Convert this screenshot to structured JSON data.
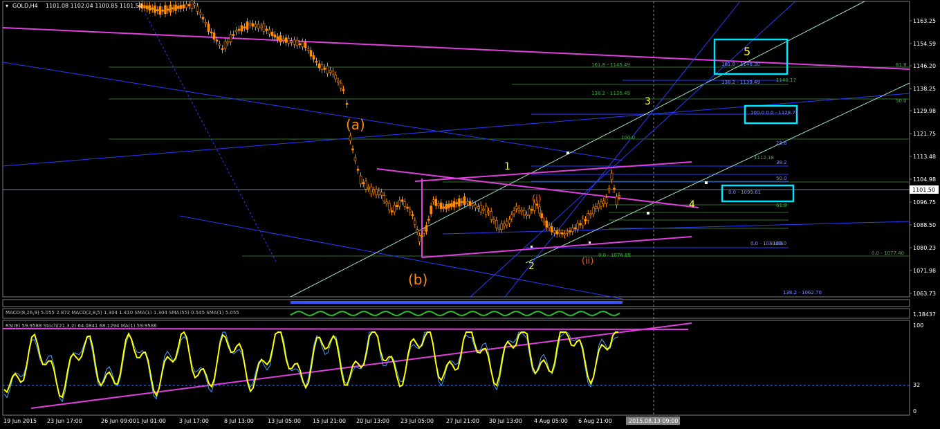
{
  "header": {
    "symbol": "GOLD,H4",
    "ohlc": "1101.08 1102.04 1100.85 1101.50"
  },
  "indicators": {
    "macd_label": "MACD(8,26,9) 5.055 2.872 MACD(2,8,5) 1.304 1.410 SMA(1) 1.304 SMA(55) 0.545 SMA(1) 5.055",
    "macd_right_value": "1.18437",
    "rsi_label": "RSI(E) 59.9588 Stoch(21,3,2) 64.0841 68.1294 MA(1) 59.9588"
  },
  "price_axis": {
    "labels": [
      "1163.25",
      "1154.59",
      "1146.20",
      "1138.25",
      "1129.98",
      "1121.75",
      "1113.48",
      "1104.98",
      "1096.75",
      "1088.50",
      "1080.23",
      "1071.98",
      "1063.73"
    ],
    "current_price": "1101.50"
  },
  "rsi_axis": {
    "labels": [
      "100",
      "32",
      "0"
    ]
  },
  "time_axis": {
    "labels": [
      "19 Jun 2015",
      "23 Jun 17:00",
      "26 Jun 09:00",
      "1 Jul 01:00",
      "3 Jul 17:00",
      "8 Jul 13:00",
      "13 Jul 05:00",
      "15 Jul 21:00",
      "20 Jul 13:00",
      "23 Jul 05:00",
      "27 Jul 21:00",
      "30 Jul 13:00",
      "4 Aug 05:00",
      "6 Aug 21:00"
    ],
    "cursor_time": "2015.08.13 09:00"
  },
  "wave_labels": {
    "a": "(a)",
    "b": "(b)",
    "w1": "1",
    "w2": "2",
    "w3": "3",
    "w4": "4",
    "w5": "5",
    "i": "(i)",
    "ii": "(ii)"
  },
  "fib_labels": [
    "161.8 - 1145.49",
    "138.2 - 1135.49",
    "100.0",
    "161.8 - 1146.30",
    "138.2 - 1139.49",
    "1140.17",
    "100.0 0.0 - 1128.72",
    "50.0",
    "38.2",
    "23.6",
    "0.0 - 1099.61",
    "61.8",
    "0.0 - 1080.88",
    "100.0",
    "0.0 - 1076.88",
    "0.0 - 1077.40",
    "138.2 - 1062.70",
    "1112.18",
    "61.8",
    "50.0"
  ],
  "colors": {
    "background": "#000000",
    "candle": "#ff8c00",
    "trendline_magenta": "#e040e0",
    "trendline_blue": "#2a3cff",
    "fib_green": "#2f7a2f",
    "rsi_yellow": "#ffff00",
    "highlight_cyan": "#00e5ff",
    "wave_orange": "#ff8c1a",
    "wave_yellow": "#ffff33"
  }
}
